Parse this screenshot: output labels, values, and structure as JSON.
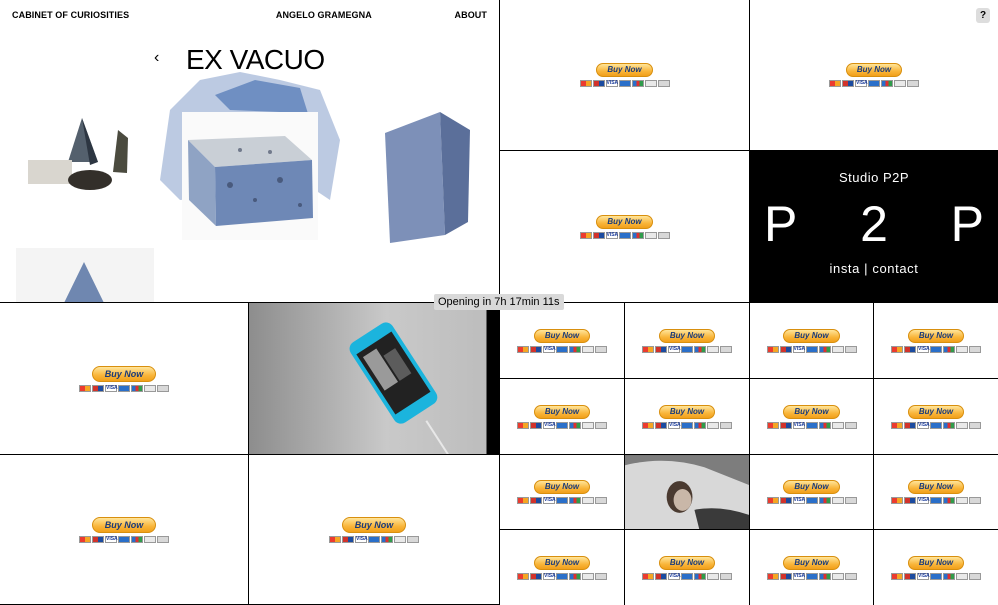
{
  "header": {
    "left_link": "CABINET OF CURIOSITIES",
    "center_link": "ANGELO GRAMEGNA",
    "right_link": "ABOUT"
  },
  "hero": {
    "title": "EX VACUO",
    "prev_arrow": "‹"
  },
  "help_label": "?",
  "buy_label": "Buy Now",
  "p2p": {
    "studio": "Studio P2P",
    "letters": [
      "P",
      "2",
      "P"
    ],
    "links": "insta | contact"
  },
  "status": {
    "opening": "Opening in 7h 17min 11s"
  }
}
